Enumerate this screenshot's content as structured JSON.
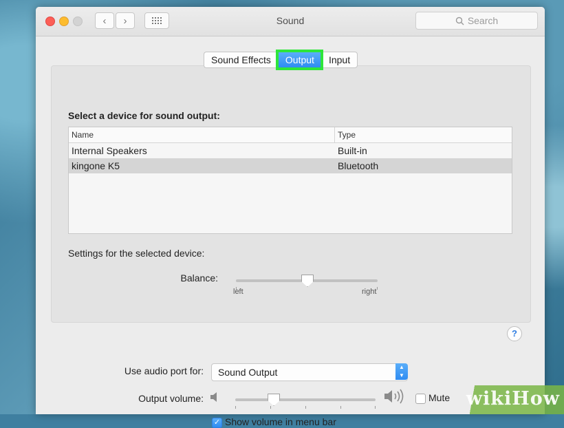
{
  "window": {
    "title": "Sound",
    "search_placeholder": "Search"
  },
  "tabs": [
    {
      "label": "Sound Effects",
      "selected": false
    },
    {
      "label": "Output",
      "selected": true
    },
    {
      "label": "Input",
      "selected": false
    }
  ],
  "device_section": {
    "title": "Select a device for sound output:",
    "columns": [
      "Name",
      "Type"
    ],
    "rows": [
      {
        "name": "Internal Speakers",
        "type": "Built-in",
        "selected": false
      },
      {
        "name": "kingone K5",
        "type": "Bluetooth",
        "selected": true
      }
    ]
  },
  "settings": {
    "title": "Settings for the selected device:",
    "balance_label": "Balance:",
    "balance_left": "left",
    "balance_right": "right",
    "balance_value": 0.5
  },
  "help": {
    "glyph": "?"
  },
  "audio_port": {
    "label": "Use audio port for:",
    "value": "Sound Output"
  },
  "output_volume": {
    "label": "Output volume:",
    "value": 0.27,
    "mute_label": "Mute",
    "mute_checked": false
  },
  "menu_bar_option": {
    "label": "Show volume in menu bar",
    "checked": true
  },
  "watermark": {
    "text": "wikiHow"
  },
  "colors": {
    "accent": "#2f8cf2",
    "highlight": "#2fe53b"
  }
}
